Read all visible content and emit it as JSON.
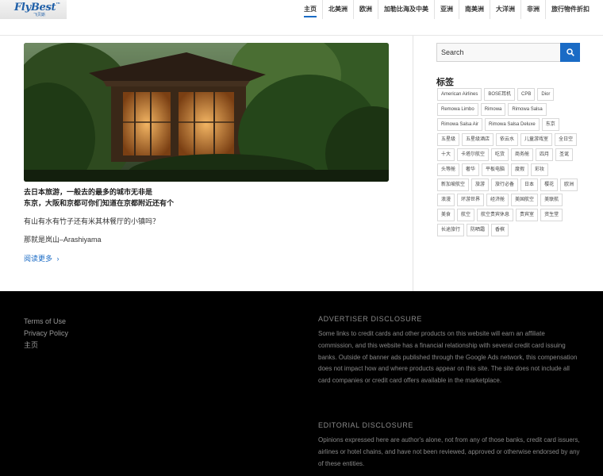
{
  "header": {
    "logo_text": "FlyBest",
    "logo_mark": "™",
    "logo_sub": "飞贝斯",
    "nav": [
      {
        "label": "主页",
        "active": true
      },
      {
        "label": "北美洲"
      },
      {
        "label": "欧洲"
      },
      {
        "label": "加勒比海及中美"
      },
      {
        "label": "亚洲"
      },
      {
        "label": "南美洲"
      },
      {
        "label": "大洋洲"
      },
      {
        "label": "非洲"
      },
      {
        "label": "旅行物件折扣"
      }
    ]
  },
  "post": {
    "title_line1": "去日本旅游，一般去的最多的城市无非是",
    "title_line2": "东京，大阪和京都可你们知道在京都附近还有个",
    "para1": "有山有水有竹子还有米其林餐厅的小镇吗？",
    "para2": "那就是岚山–Arashiyama",
    "read_more": "阅读更多"
  },
  "sidebar": {
    "search_placeholder": "Search",
    "tags_title": "标签",
    "tags": [
      "American Airlines",
      "BOSE耳机",
      "CPB",
      "Dior",
      "Remowa Limbo",
      "Rimowa",
      "Rimowa Salsa",
      "Rimowa Salsa Air",
      "Rimowa Salsa Deluxe",
      "东京",
      "五星级",
      "五星级酒店",
      "依云水",
      "儿童游戏室",
      "全日空",
      "十大",
      "卡塔尔航空",
      "吃货",
      "商务舱",
      "四月",
      "圣诞",
      "头等舱",
      "奢华",
      "平板电脑",
      "度假",
      "彩妆",
      "新加坡航空",
      "旅游",
      "旅行必备",
      "日本",
      "樱花",
      "欧洲",
      "浪漫",
      "环游世界",
      "经济舱",
      "美国航空",
      "美联航",
      "美食",
      "航空",
      "航空贵宾休息",
      "贵宾室",
      "资生堂",
      "长途旅行",
      "防晒霜",
      "香槟"
    ]
  },
  "footer": {
    "links": [
      "Terms of Use",
      "Privacy Policy",
      "主页"
    ],
    "advertiser_title": "ADVERTISER DISCLOSURE",
    "advertiser_text": "Some links to credit cards and other products on this website will earn an affiliate commission, and this website has a financial relationship with several credit card issuing banks. Outside of banner ads published through the Google Ads network, this compensation does not impact how and where products appear on this site. The site does not include all card companies or credit card offers available in the marketplace.",
    "editorial_title": "EDITORIAL DISCLOSURE",
    "editorial_text": "Opinions expressed here are author's alone, not from any of those banks, credit card issuers, airlines or hotel chains, and have not been reviewed, approved or otherwise endorsed by any of these entities."
  },
  "colors": {
    "accent": "#1a6bc5",
    "footer_bg": "#000000"
  }
}
